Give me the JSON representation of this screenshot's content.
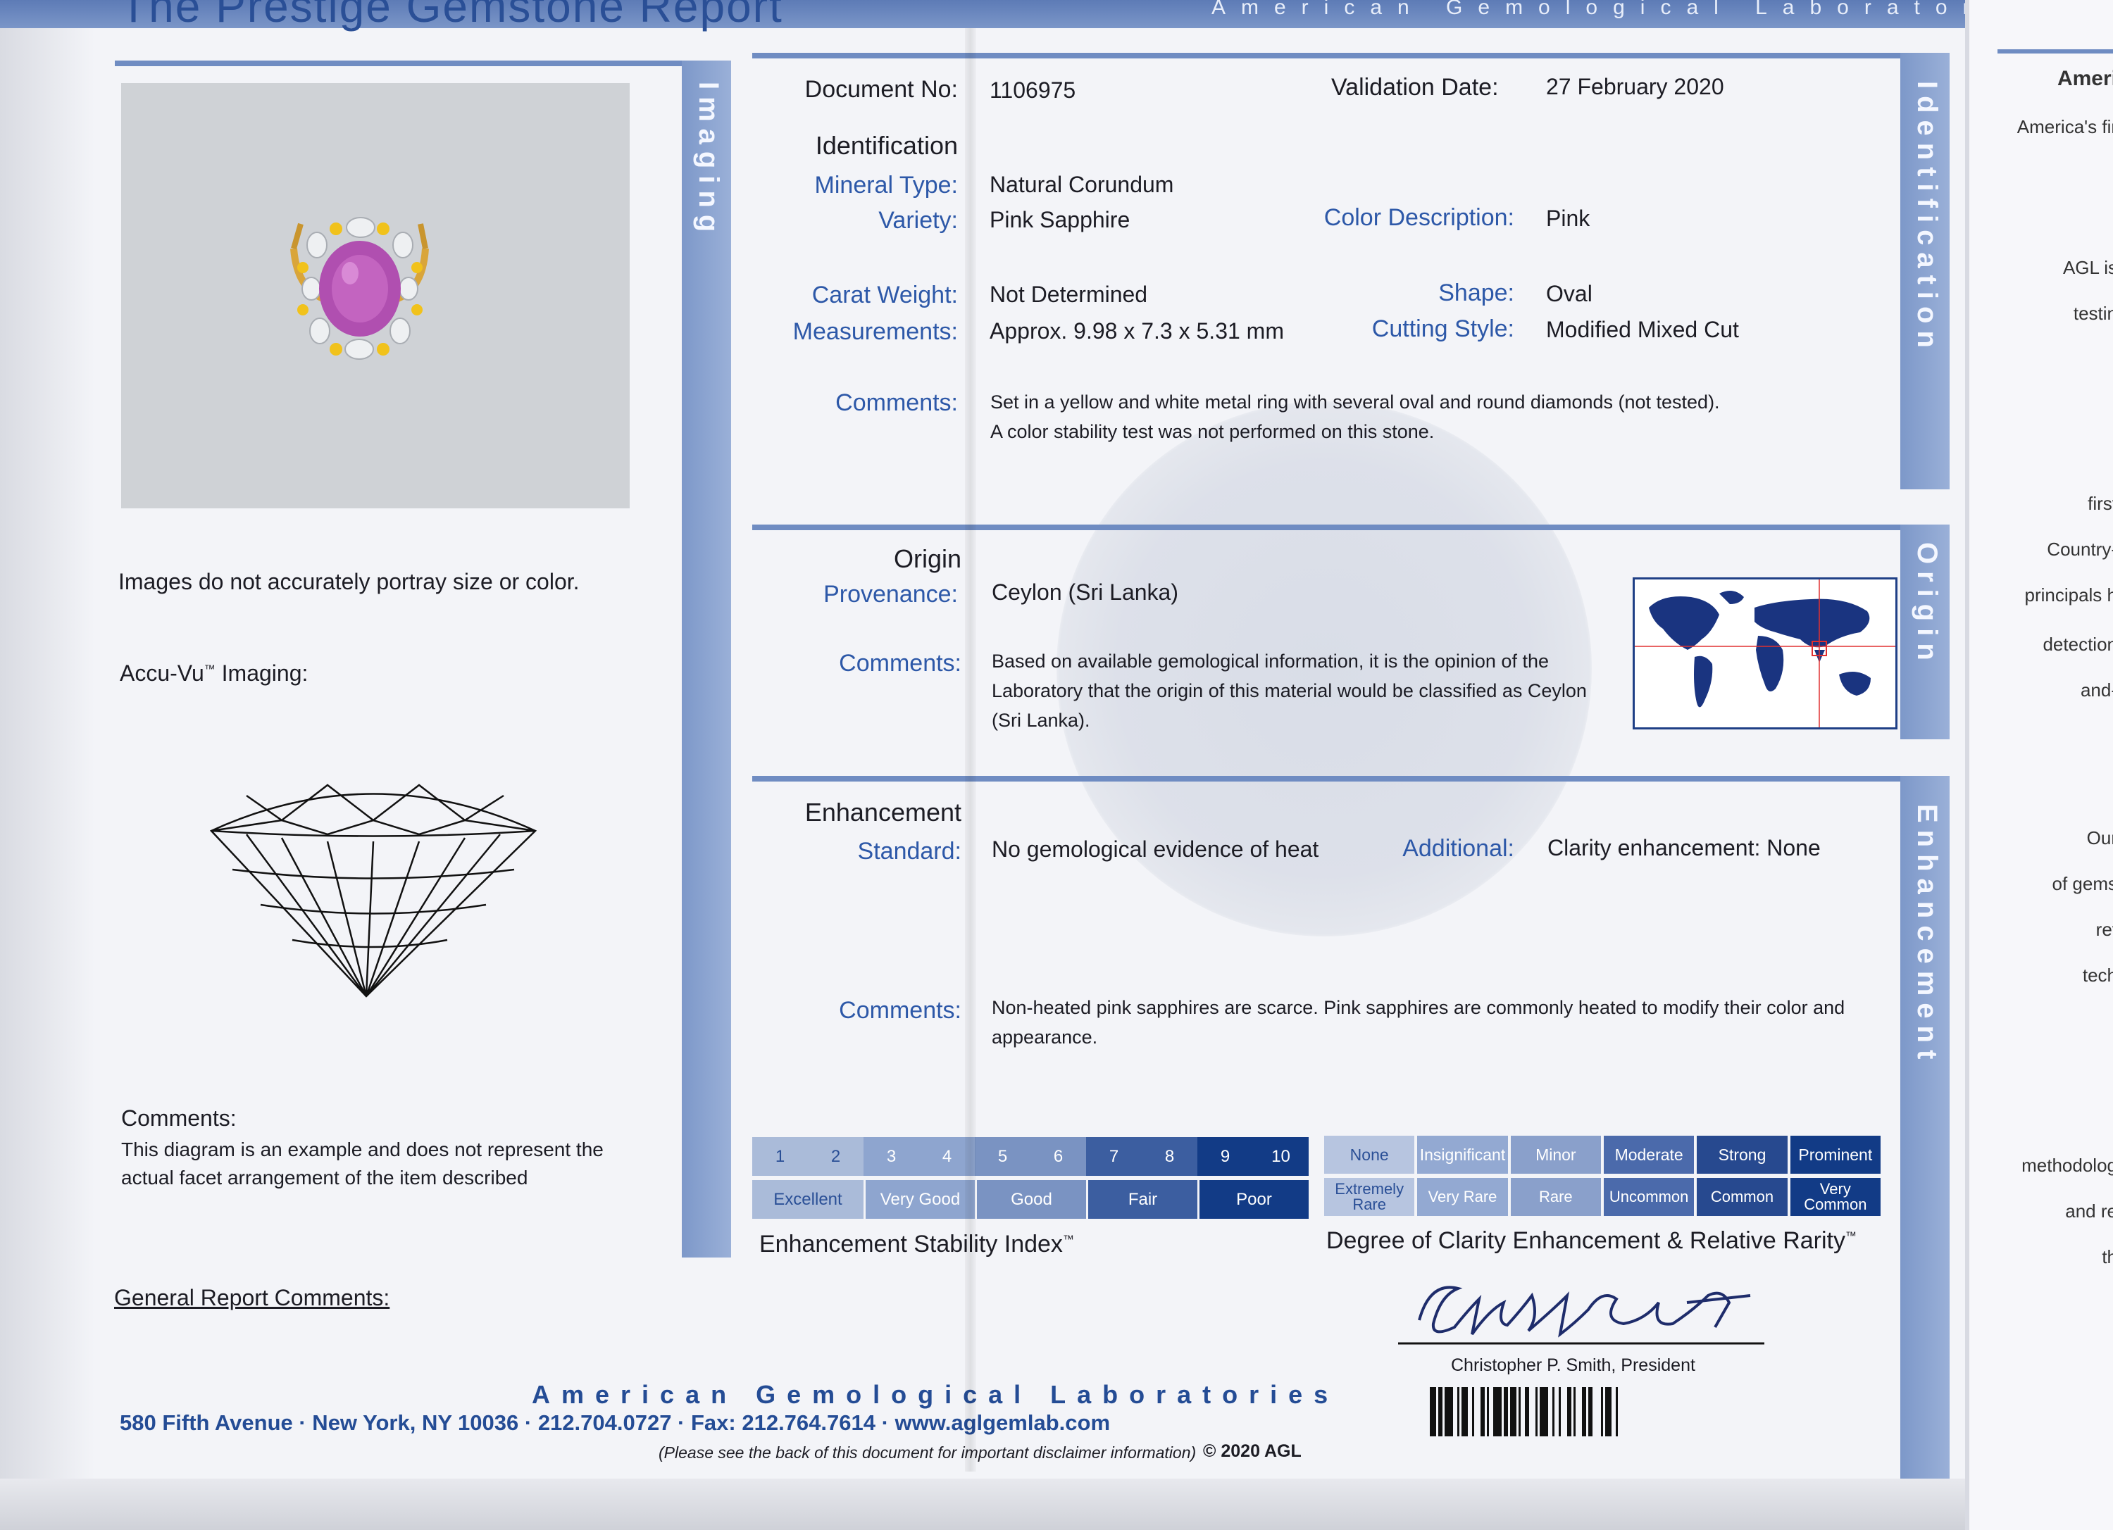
{
  "header": {
    "title": "The Prestige Gemstone Report",
    "tagline": "American Gemological Laboratories"
  },
  "imaging": {
    "tab_label": "Imaging",
    "image_note": "Images do not accurately portray size or color.",
    "accu_vu_label": "Accu-Vu",
    "accu_vu_tm": "™",
    "accu_vu_suffix": "Imaging:",
    "comments_label": "Comments:",
    "comments_text": "This diagram is an example and does not represent the actual facet arrangement of the item described",
    "general_comments_label": "General Report Comments:"
  },
  "identification": {
    "tab_label": "Identification",
    "document_no_label": "Document No:",
    "document_no": "1106975",
    "validation_date_label": "Validation Date:",
    "validation_date": "27 February 2020",
    "section_label": "Identification",
    "mineral_type_label": "Mineral Type:",
    "mineral_type": "Natural Corundum",
    "variety_label": "Variety:",
    "variety": "Pink Sapphire",
    "color_description_label": "Color Description:",
    "color_description": "Pink",
    "carat_weight_label": "Carat Weight:",
    "carat_weight": "Not Determined",
    "shape_label": "Shape:",
    "shape": "Oval",
    "measurements_label": "Measurements:",
    "measurements": "Approx. 9.98 x 7.3 x 5.31 mm",
    "cutting_style_label": "Cutting Style:",
    "cutting_style": "Modified Mixed Cut",
    "comments_label": "Comments:",
    "comments_line1": "Set in a yellow and white metal ring with several oval and round diamonds (not tested).",
    "comments_line2": "A color stability test was not performed on this stone."
  },
  "origin": {
    "tab_label": "Origin",
    "section_label": "Origin",
    "provenance_label": "Provenance:",
    "provenance": "Ceylon (Sri Lanka)",
    "comments_label": "Comments:",
    "comments_text": "Based on available gemological information, it is the opinion of the Laboratory that the origin of this material would be classified as Ceylon (Sri Lanka)."
  },
  "enhancement": {
    "tab_label": "Enhancement",
    "section_label": "Enhancement",
    "standard_label": "Standard:",
    "standard": "No gemological evidence of heat",
    "additional_label": "Additional:",
    "additional": "Clarity enhancement: None",
    "comments_label": "Comments:",
    "comments_text": "Non-heated pink sapphires are scarce. Pink sapphires are commonly heated to modify their color and appearance."
  },
  "stability_index": {
    "title": "Enhancement Stability Index",
    "tm": "™",
    "numbers": [
      "1",
      "2",
      "3",
      "4",
      "5",
      "6",
      "7",
      "8",
      "9",
      "10"
    ],
    "grades": [
      "Excellent",
      "Very Good",
      "Good",
      "Fair",
      "Poor"
    ],
    "colors": [
      "#aabbd9",
      "#8ea5cf",
      "#7a93c2",
      "#3c5ea0",
      "#123b86"
    ]
  },
  "clarity_scale": {
    "title": "Degree of Clarity Enhancement & Relative Rarity",
    "tm": "™",
    "degrees": [
      "None",
      "Insignificant",
      "Minor",
      "Moderate",
      "Strong",
      "Prominent"
    ],
    "rarity": [
      "Extremely Rare",
      "Very Rare",
      "Rare",
      "Uncommon",
      "Common",
      "Very Common"
    ],
    "colors": [
      "#b7c5e0",
      "#93a9d2",
      "#8aa0cb",
      "#4b6aab",
      "#27498f",
      "#123b86"
    ]
  },
  "signature": {
    "name": "Christopher P. Smith, President"
  },
  "footer": {
    "lab_name": "American Gemological Laboratories",
    "address": "580 Fifth Avenue  ·  New York, NY 10036  ·  212.704.0727  ·  Fax: 212.764.7614  ·  www.aglgemlab.com",
    "disclaimer": "(Please see the back of this document for important disclaimer information)",
    "copyright": "© 2020 AGL"
  },
  "right_page": {
    "lines": [
      "Ameri",
      "America's fir",
      "AGL is",
      "testin",
      "first",
      "Country-",
      "principals h",
      "detection",
      "and-",
      "Our",
      "of gems",
      "ref",
      "tech",
      "methodolog",
      "and re",
      "th"
    ]
  }
}
